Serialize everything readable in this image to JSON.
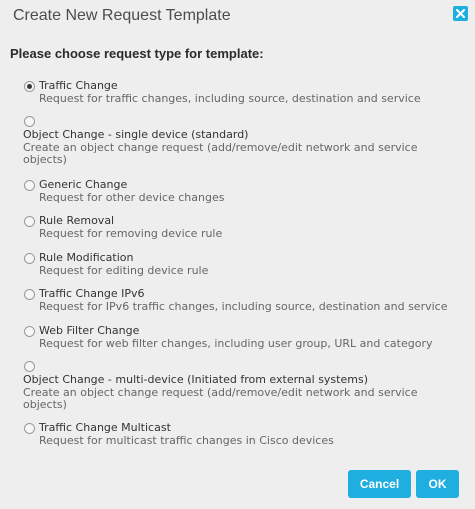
{
  "dialog": {
    "title": "Create New Request Template",
    "close_icon": "close-icon",
    "prompt": "Please choose request type for template:"
  },
  "options": [
    {
      "label": "Traffic Change",
      "description": "Request for traffic changes, including source, destination and service",
      "checked": true
    },
    {
      "label": "Object Change - single device (standard)",
      "description": "Create an object change request (add/remove/edit network and service objects)",
      "checked": false
    },
    {
      "label": "Generic Change",
      "description": "Request for other device changes",
      "checked": false
    },
    {
      "label": "Rule Removal",
      "description": "Request for removing device rule",
      "checked": false
    },
    {
      "label": "Rule Modification",
      "description": "Request for editing device rule",
      "checked": false
    },
    {
      "label": "Traffic Change IPv6",
      "description": "Request for IPv6 traffic changes, including source, destination and service",
      "checked": false
    },
    {
      "label": "Web Filter Change",
      "description": "Request for web filter changes, including user group, URL and category",
      "checked": false
    },
    {
      "label": "Object Change - multi-device (Initiated from external systems)",
      "description": "Create an object change request (add/remove/edit network and service objects)",
      "checked": false
    },
    {
      "label": "Traffic Change Multicast",
      "description": "Request for multicast traffic changes in Cisco devices",
      "checked": false
    }
  ],
  "buttons": {
    "cancel_label": "Cancel",
    "ok_label": "OK"
  },
  "colors": {
    "accent": "#1eaee0",
    "background": "#eeeeef"
  }
}
